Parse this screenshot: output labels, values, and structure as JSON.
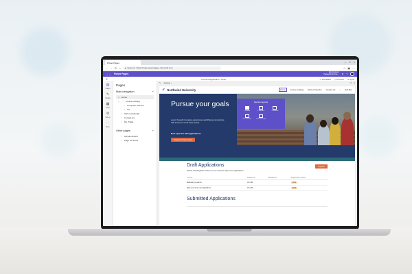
{
  "browser": {
    "tab_title": "Power Pages",
    "url": "https://make.powerpages.microsoft.com",
    "security_label": "Secured"
  },
  "app": {
    "name": "Power Pages",
    "environment_label": "Environment",
    "environment_name": "PagesAdminPres..."
  },
  "command_bar": {
    "breadcrumb": "Course Registration - Draft",
    "feedback": "Feedback",
    "preview": "Preview",
    "sync": "Sync"
  },
  "rail": {
    "items": [
      {
        "label": "Pages",
        "icon": "page-icon"
      },
      {
        "label": "Styling",
        "icon": "brush-icon"
      },
      {
        "label": "Data",
        "icon": "table-icon"
      },
      {
        "label": "Set up",
        "icon": "gear-icon"
      },
      {
        "label": "More",
        "icon": "more-icon"
      }
    ]
  },
  "pages_panel": {
    "title": "Pages",
    "main_nav_title": "Main navigation",
    "main_items": [
      "Home",
      "Course Catalog",
      "Computer Science",
      "Art",
      "School Calendar",
      "Contact Us",
      "My Profile"
    ],
    "other_title": "Other pages",
    "other_items": [
      "Access denied",
      "Page not found"
    ]
  },
  "canvas": {
    "page_label": "Home"
  },
  "site": {
    "name": "Northwind University",
    "nav": [
      "Home",
      "Course Catalog",
      "School Calendar",
      "Contact Us",
      "Ed's Box"
    ],
    "hero_title": "Pursue your goals",
    "hero_desc": "Learn through innovative experiences and lifelong connections with access to world class faculty.",
    "hero_open": "Now open for fall registrations.",
    "hero_cta": "Register for fall courses",
    "section_panel": {
      "title": "Section layouts",
      "options": [
        "1 column",
        "2 columns",
        "3 columns",
        "One third left",
        "One third right",
        ""
      ]
    },
    "draft_title": "Draft Applications",
    "draft_sub": "Select the Register button to see courses open for registration.",
    "register": "Register",
    "draft_headers": [
      "Course",
      "Student ID",
      "Modified on",
      "Registration status"
    ],
    "draft_rows": [
      {
        "course": "Marketing systems",
        "id": "CS-101",
        "modified": "",
        "status": "Draft"
      },
      {
        "course": "Data structures and algorithms",
        "id": "CS-201",
        "modified": "",
        "status": "Draft"
      }
    ],
    "submitted_title": "Submitted Applications"
  },
  "colors": {
    "brand": "#5e50c9",
    "hero": "#233a6b",
    "accent": "#e0683a"
  }
}
